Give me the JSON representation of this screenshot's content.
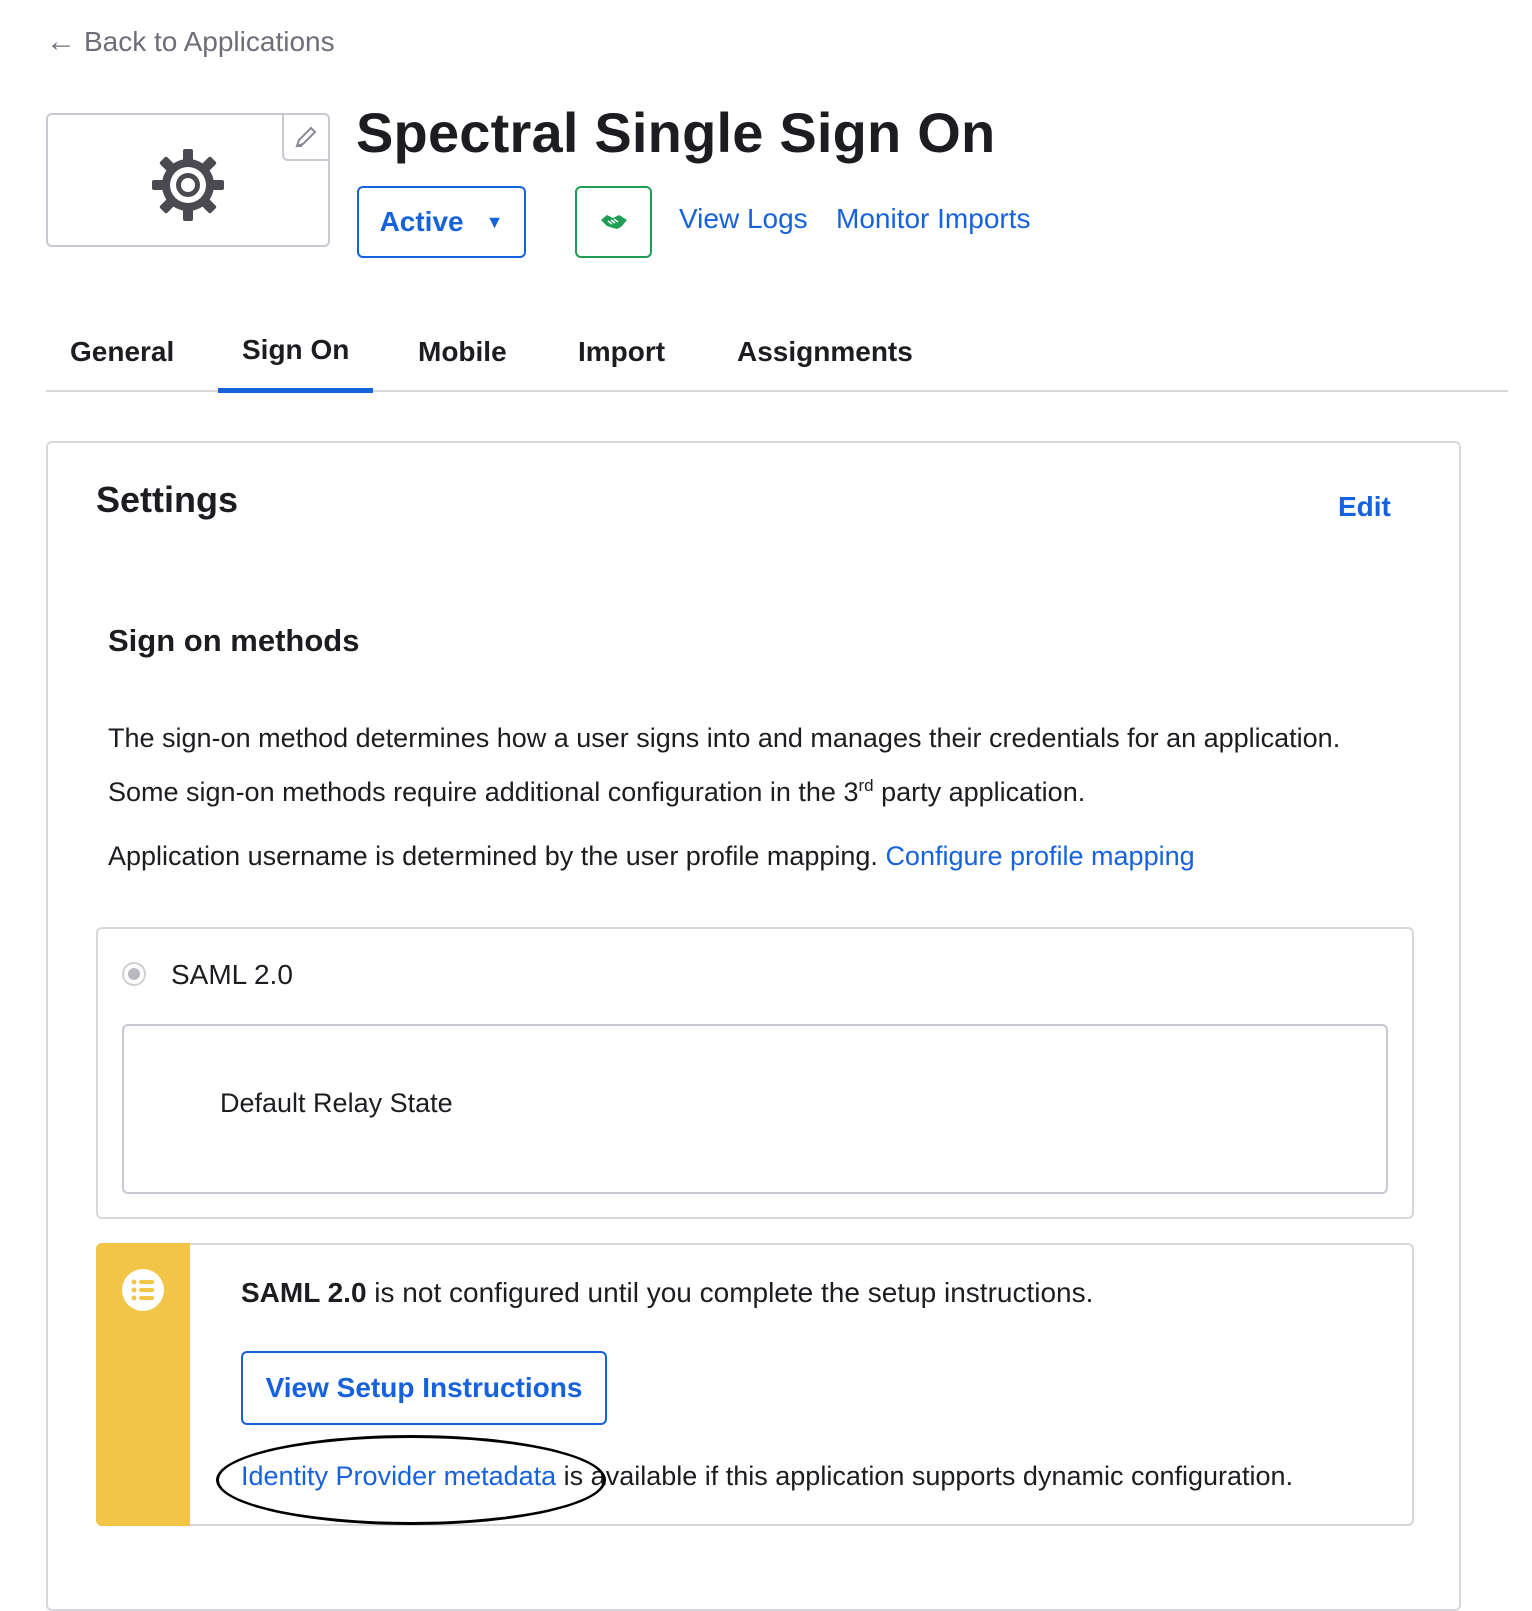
{
  "nav": {
    "back_label": "Back to Applications"
  },
  "header": {
    "title": "Spectral Single Sign On",
    "status_label": "Active",
    "view_logs": "View Logs",
    "monitor_imports": "Monitor Imports"
  },
  "tabs": [
    {
      "label": "General",
      "active": false
    },
    {
      "label": "Sign On",
      "active": true
    },
    {
      "label": "Mobile",
      "active": false
    },
    {
      "label": "Import",
      "active": false
    },
    {
      "label": "Assignments",
      "active": false
    }
  ],
  "settings": {
    "title": "Settings",
    "edit_label": "Edit",
    "section_title": "Sign on methods",
    "description_part1": "The sign-on method determines how a user signs into and manages their credentials for an application. Some sign-on methods require additional configuration in the 3",
    "description_sup": "rd",
    "description_part2": " party application.",
    "username_text": "Application username is determined by the user profile mapping.",
    "configure_mapping_link": "Configure profile mapping",
    "method": {
      "label": "SAML 2.0",
      "relay_state_label": "Default Relay State"
    },
    "callout": {
      "msg_bold": "SAML 2.0",
      "msg_rest": " is not configured until you complete the setup instructions.",
      "button_label": "View Setup Instructions",
      "metadata_link": "Identity Provider metadata",
      "metadata_rest": " is available if this application supports dynamic configuration."
    }
  },
  "colors": {
    "link": "#1662dd",
    "callout_stripe": "#f2c548",
    "handshake_green": "#1f9d55",
    "border": "#d7d7dc"
  }
}
